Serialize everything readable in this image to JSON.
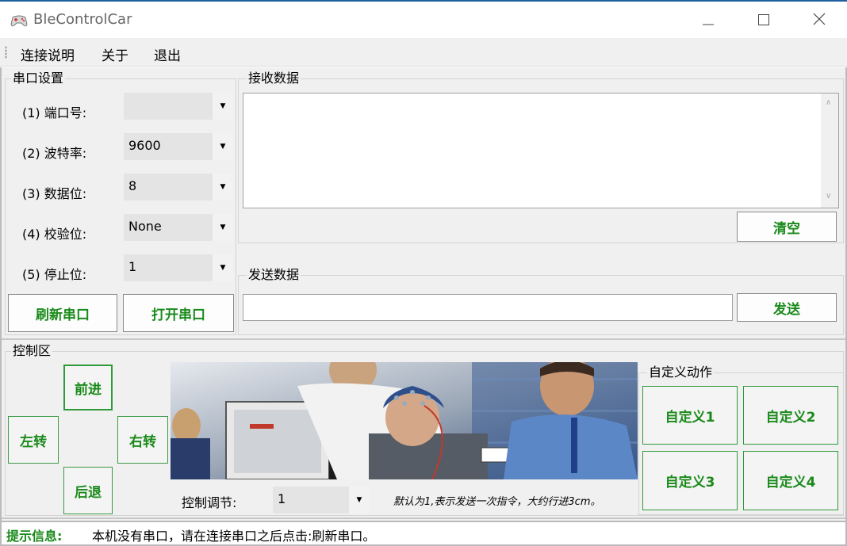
{
  "window": {
    "title": "BleControlCar"
  },
  "menu": {
    "items": [
      "连接说明",
      "关于",
      "退出"
    ]
  },
  "serial": {
    "group_title": "串口设置",
    "port_label": "(1)  端口号:",
    "port_value": "",
    "baud_label": "(2)  波特率:",
    "baud_value": "9600",
    "databits_label": "(3)  数据位:",
    "databits_value": "8",
    "parity_label": "(4)  校验位:",
    "parity_value": "None",
    "stopbits_label": "(5)  停止位:",
    "stopbits_value": "1",
    "refresh_button": "刷新串口",
    "open_button": "打开串口"
  },
  "receive": {
    "group_title": "接收数据",
    "clear_button": "清空"
  },
  "send": {
    "group_title": "发送数据",
    "send_button": "发送"
  },
  "control": {
    "group_title": "控制区",
    "forward_button": "前进",
    "left_button": "左转",
    "right_button": "右转",
    "back_button": "后退",
    "adjust_label": "控制调节:",
    "adjust_value": "1",
    "hint_text": "默认为1,表示发送一次指令，大约行进3cm。"
  },
  "custom": {
    "group_title": "自定义动作",
    "buttons": [
      "自定义1",
      "自定义2",
      "自定义3",
      "自定义4"
    ]
  },
  "status": {
    "label": "提示信息:",
    "message": "本机没有串口，请在连接串口之后点击:刷新串口。"
  },
  "colors": {
    "accent_green": "#1a8a1a",
    "button_border_green": "#2f9a3a",
    "title_border": "#1f5fa0"
  }
}
